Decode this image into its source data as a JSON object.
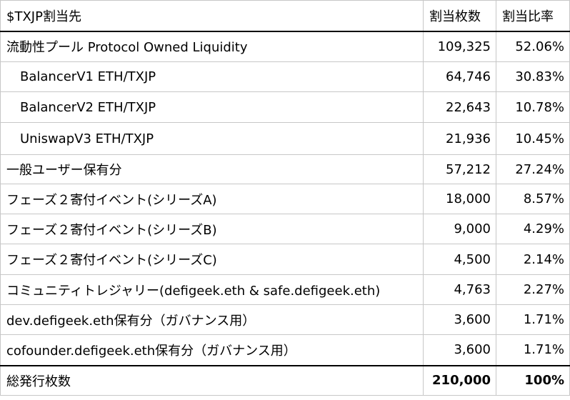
{
  "table": {
    "header": {
      "col1": "$TXJP割当先",
      "col2": "割当枚数",
      "col3": "割当比率"
    },
    "rows": [
      {
        "name": "流動性プール Protocol Owned Liquidity",
        "amount": "109,325",
        "ratio": "52.06%",
        "indent": false
      },
      {
        "name": "BalancerV1 ETH/TXJP",
        "amount": "64,746",
        "ratio": "30.83%",
        "indent": true
      },
      {
        "name": "BalancerV2 ETH/TXJP",
        "amount": "22,643",
        "ratio": "10.78%",
        "indent": true
      },
      {
        "name": "UniswapV3 ETH/TXJP",
        "amount": "21,936",
        "ratio": "10.45%",
        "indent": true
      },
      {
        "name": "一般ユーザー保有分",
        "amount": "57,212",
        "ratio": "27.24%",
        "indent": false
      },
      {
        "name": "フェーズ２寄付イベント(シリーズA)",
        "amount": "18,000",
        "ratio": "8.57%",
        "indent": false
      },
      {
        "name": "フェーズ２寄付イベント(シリーズB)",
        "amount": "9,000",
        "ratio": "4.29%",
        "indent": false
      },
      {
        "name": "フェーズ２寄付イベント(シリーズC)",
        "amount": "4,500",
        "ratio": "2.14%",
        "indent": false
      },
      {
        "name": "コミュニティトレジャリー(defigeek.eth & safe.defigeek.eth)",
        "amount": "4,763",
        "ratio": "2.27%",
        "indent": false
      },
      {
        "name": "dev.defigeek.eth保有分（ガバナンス用）",
        "amount": "3,600",
        "ratio": "1.71%",
        "indent": false
      },
      {
        "name": "cofounder.defigeek.eth保有分（ガバナンス用）",
        "amount": "3,600",
        "ratio": "1.71%",
        "indent": false
      }
    ],
    "total": {
      "name": "総発行枚数",
      "amount": "210,000",
      "ratio": "100%"
    }
  }
}
